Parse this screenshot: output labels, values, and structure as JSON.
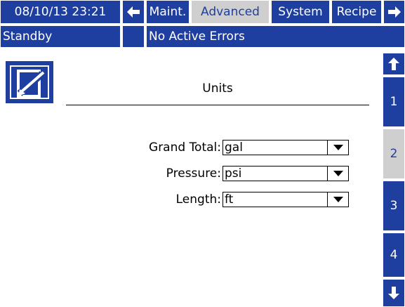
{
  "header": {
    "datetime": "08/10/13 23:21",
    "back_arrow_icon": "left-arrow",
    "forward_arrow_icon": "right-arrow",
    "tabs": [
      {
        "label": "Maint.",
        "active": false
      },
      {
        "label": "Advanced",
        "active": true
      },
      {
        "label": "System",
        "active": false
      },
      {
        "label": "Recipe",
        "active": false
      }
    ]
  },
  "status": {
    "state": "Standby",
    "errors": "No Active Errors"
  },
  "page": {
    "icon": "edit-pencil-icon",
    "title": "Units"
  },
  "fields": [
    {
      "label": "Grand Total:",
      "value": "gal"
    },
    {
      "label": "Pressure:",
      "value": "psi"
    },
    {
      "label": "Length:",
      "value": "ft"
    }
  ],
  "side_nav": {
    "up_icon": "up-arrow",
    "down_icon": "down-arrow",
    "pages": [
      {
        "label": "1",
        "active": false
      },
      {
        "label": "2",
        "active": true
      },
      {
        "label": "3",
        "active": false
      },
      {
        "label": "4",
        "active": false
      }
    ]
  },
  "colors": {
    "primary": "#1f3fa0",
    "active_tab_bg": "#cfcfcf",
    "background": "#ffffff"
  }
}
